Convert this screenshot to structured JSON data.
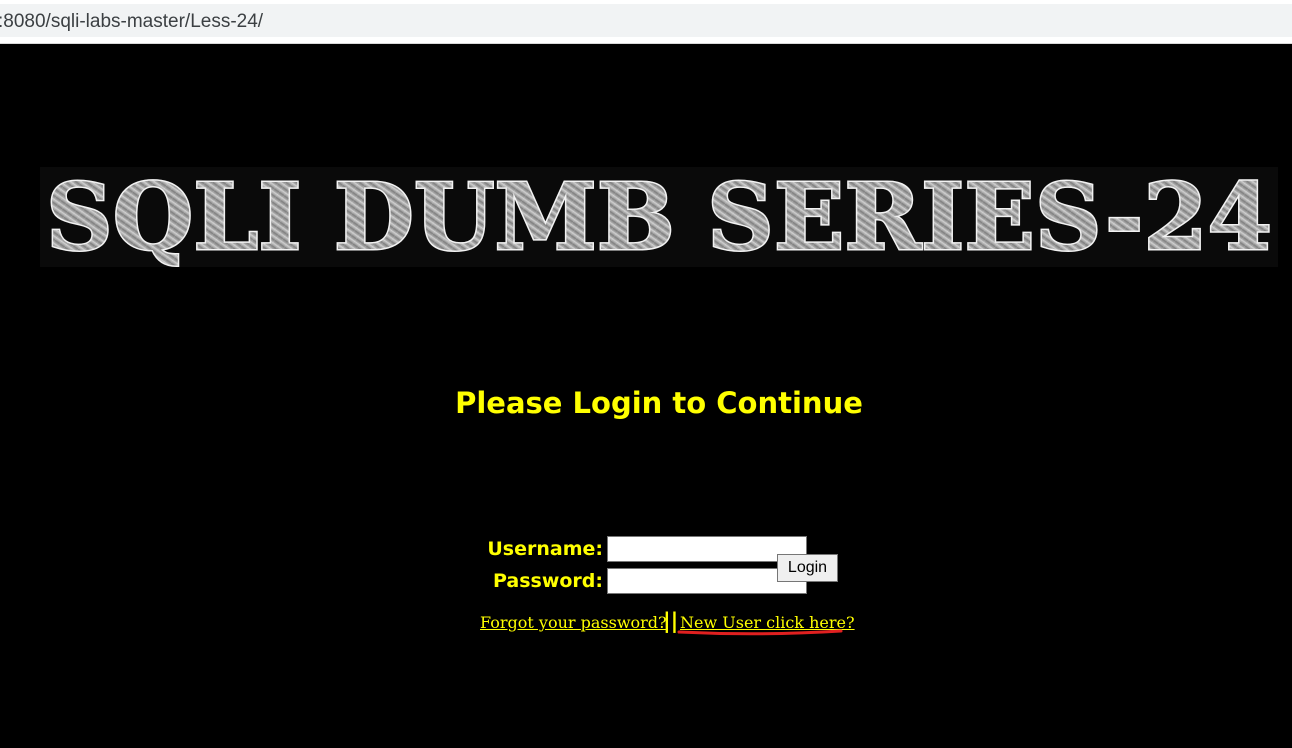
{
  "browser": {
    "url": ":8080/sqli-labs-master/Less-24/"
  },
  "banner": {
    "text": "SQLI DUMB SERIES-24"
  },
  "login": {
    "title": "Please Login to Continue",
    "username_label": "Username:",
    "password_label": "Password:",
    "username_value": "",
    "password_value": "",
    "login_button": "Login"
  },
  "links": {
    "forgot_password": "Forgot your password?",
    "separator": "||",
    "new_user": "New User click here?"
  },
  "colors": {
    "page_background": "#000000",
    "text_accent": "#ffff00",
    "annotation_underline": "#e02020"
  }
}
